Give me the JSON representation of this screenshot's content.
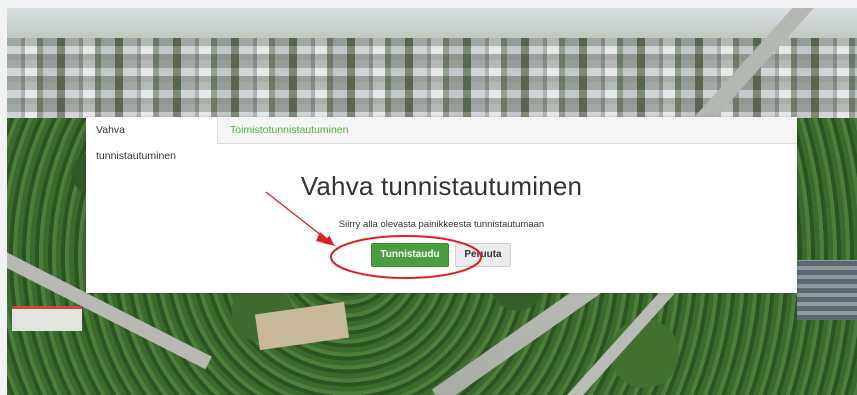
{
  "tabs": [
    {
      "label": "Vahva tunnistautuminen",
      "active": true
    },
    {
      "label": "Toimistotunnistautuminen",
      "active": false
    }
  ],
  "main": {
    "heading": "Vahva tunnistautuminen",
    "instruction": "Siirry alla olevasta painikkeesta tunnistautumaan",
    "primary_button": "Tunnistaudu",
    "secondary_button": "Peruuta"
  },
  "colors": {
    "primary_button": "#4a9e3f",
    "inactive_tab": "#4cae4c",
    "annotation": "#e01e1e"
  },
  "icons": [
    "annotation-arrow",
    "annotation-circle"
  ]
}
